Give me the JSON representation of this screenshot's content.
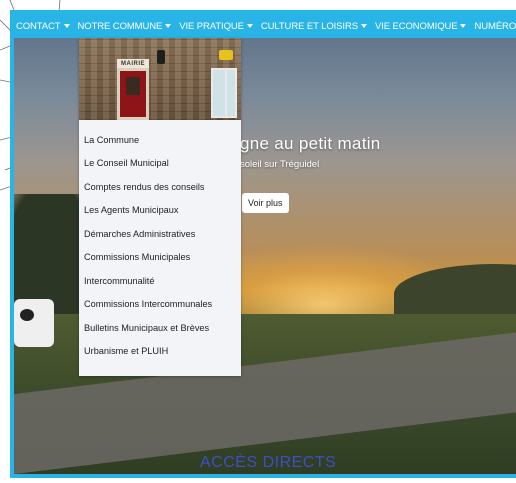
{
  "nav": {
    "items": [
      {
        "label": "CONTACT",
        "caret": true
      },
      {
        "label": "NOTRE COMMUNE",
        "caret": true
      },
      {
        "label": "VIE PRATIQUE",
        "caret": true
      },
      {
        "label": "CULTURE ET LOISIRS",
        "caret": true
      },
      {
        "label": "VIE ECONOMIQUE",
        "caret": true
      },
      {
        "label": "NUMÉROS UTILES",
        "caret": false
      }
    ],
    "background_color": "#28b4e6"
  },
  "dropdown": {
    "image_sign_text": "MAIRIE",
    "items": [
      "La Commune",
      "Le Conseil Municipal",
      "Comptes rendus des conseils",
      "Les Agents Municipaux",
      "Démarches Administratives",
      "Commissions Municipales",
      "Intercommunalité",
      "Commissions Intercommunales",
      "Bulletins Municipaux et Brèves",
      "Urbanisme et PLUIH"
    ]
  },
  "hero": {
    "title": "gne au petit matin",
    "subtitle": "soleil sur Tréguidel",
    "button_label": "Voir plus"
  },
  "footer_heading": "ACCÈS DIRECTS",
  "colors": {
    "accent": "#28b4e6",
    "heading_blue": "#3b4fc8"
  }
}
